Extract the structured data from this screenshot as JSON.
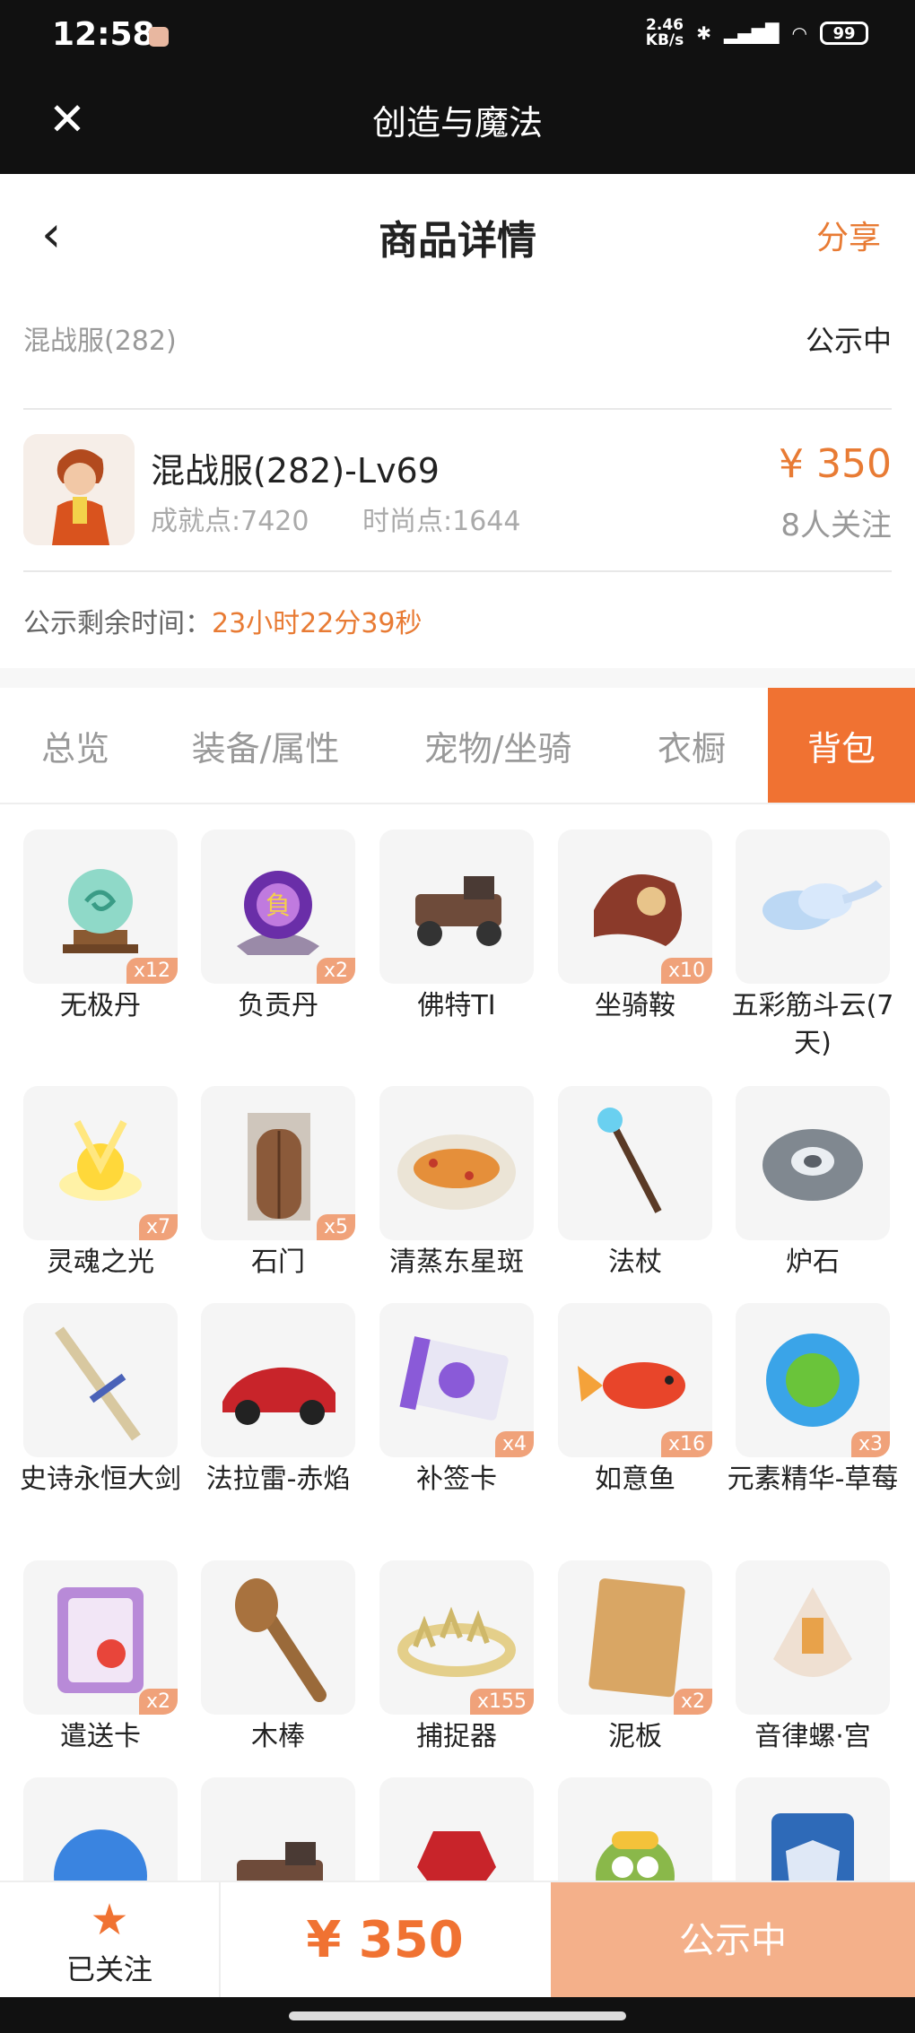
{
  "status_bar": {
    "time": "12:58",
    "speed_top": "2.46",
    "speed_bottom": "KB/s",
    "battery": "99"
  },
  "titlebar": {
    "title": "创造与魔法"
  },
  "navbar": {
    "title": "商品详情",
    "share": "分享"
  },
  "listing": {
    "server": "混战服(282)",
    "status": "公示中",
    "name": "混战服(282)-Lv69",
    "achievement": "成就点:7420",
    "fashion": "时尚点:1644",
    "price": "¥ 350",
    "followers": "8人关注",
    "countdown_label": "公示剩余时间：",
    "countdown_value": "23小时22分39秒"
  },
  "tabs": [
    "总览",
    "装备/属性",
    "宠物/坐骑",
    "衣橱",
    "背包"
  ],
  "active_tab": 4,
  "items": [
    {
      "name": "无极丹",
      "qty": "x12",
      "icon": "orb-on-stand"
    },
    {
      "name": "负贡丹",
      "qty": "x2",
      "icon": "purple-orb"
    },
    {
      "name": "佛特TI",
      "qty": "",
      "icon": "vintage-car"
    },
    {
      "name": "坐骑鞍",
      "qty": "x10",
      "icon": "saddle"
    },
    {
      "name": "五彩筋斗云(7天)",
      "qty": "",
      "icon": "cloud"
    },
    {
      "name": "灵魂之光",
      "qty": "x7",
      "icon": "golden-light"
    },
    {
      "name": "石门",
      "qty": "x5",
      "icon": "stone-door"
    },
    {
      "name": "清蒸东星斑",
      "qty": "",
      "icon": "fish-dish"
    },
    {
      "name": "法杖",
      "qty": "",
      "icon": "staff"
    },
    {
      "name": "炉石",
      "qty": "",
      "icon": "hearthstone"
    },
    {
      "name": "史诗永恒大剑",
      "qty": "",
      "icon": "great-sword"
    },
    {
      "name": "法拉雷-赤焰",
      "qty": "",
      "icon": "red-sports-car"
    },
    {
      "name": "补签卡",
      "qty": "x4",
      "icon": "sign-card"
    },
    {
      "name": "如意鱼",
      "qty": "x16",
      "icon": "koi-fish"
    },
    {
      "name": "元素精华-草莓",
      "qty": "x3",
      "icon": "strawberry-essence"
    },
    {
      "name": "遣送卡",
      "qty": "x2",
      "icon": "deport-card"
    },
    {
      "name": "木棒",
      "qty": "",
      "icon": "wooden-club"
    },
    {
      "name": "捕捉器",
      "qty": "x155",
      "icon": "catcher"
    },
    {
      "name": "泥板",
      "qty": "x2",
      "icon": "clay-tablet"
    },
    {
      "name": "音律螺·宫",
      "qty": "",
      "icon": "conch"
    },
    {
      "name": "",
      "qty": "",
      "icon": "blue-orb"
    },
    {
      "name": "",
      "qty": "",
      "icon": "vintage-car-2"
    },
    {
      "name": "",
      "qty": "",
      "icon": "red-gem"
    },
    {
      "name": "",
      "qty": "",
      "icon": "miner-creature"
    },
    {
      "name": "",
      "qty": "",
      "icon": "shield-card"
    }
  ],
  "bottom": {
    "fav_label": "已关注",
    "price": "¥ 350",
    "action": "公示中"
  },
  "colors": {
    "accent": "#f07232",
    "accent_light": "#f4b08a",
    "header": "#111111"
  }
}
